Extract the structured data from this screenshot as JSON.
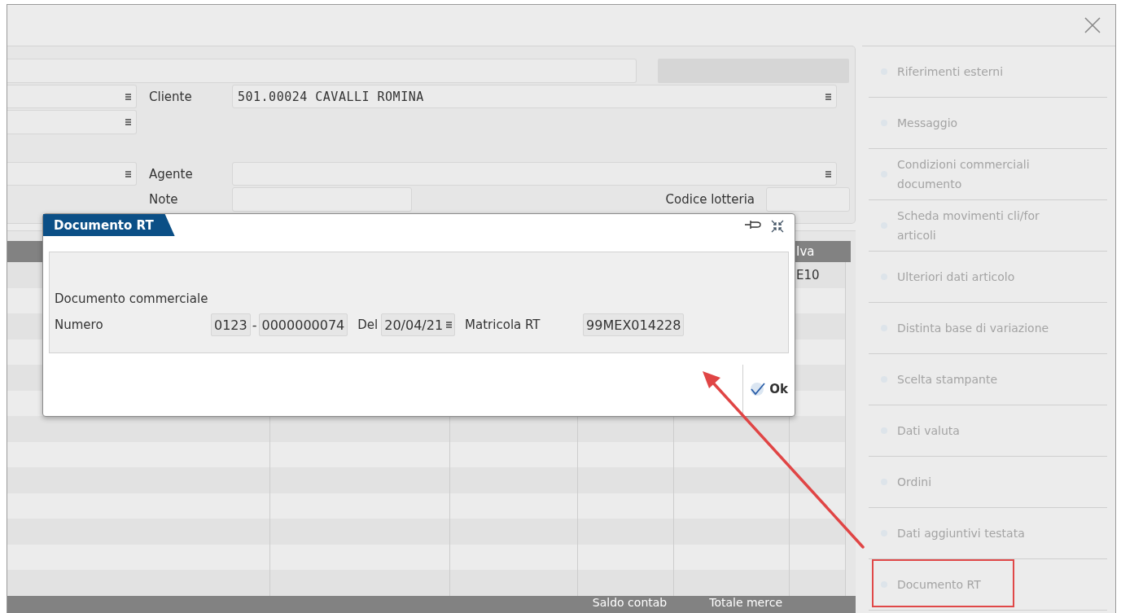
{
  "form": {
    "cliente": {
      "label": "Cliente",
      "value": "501.00024 CAVALLI ROMINA"
    },
    "agente": {
      "label": "Agente"
    },
    "note": {
      "label": "Note"
    },
    "codice_lotteria": {
      "label": "Codice lotteria"
    }
  },
  "table": {
    "iva_header": "Iva",
    "iva_values": [
      "E10"
    ]
  },
  "totals_bar": {
    "labels": [
      "Saldo contab",
      "Totale merce"
    ]
  },
  "side_menu": {
    "items": [
      {
        "label": "Riferimenti esterni",
        "highlighted": false
      },
      {
        "label": "Messaggio",
        "highlighted": false
      },
      {
        "label": "Condizioni commerciali documento",
        "highlighted": false
      },
      {
        "label": "Scheda movimenti cli/for articoli",
        "highlighted": false
      },
      {
        "label": "Ulteriori dati articolo",
        "highlighted": false
      },
      {
        "label": "Distinta base di variazione",
        "highlighted": false
      },
      {
        "label": "Scelta stampante",
        "highlighted": false
      },
      {
        "label": "Dati valuta",
        "highlighted": false
      },
      {
        "label": "Ordini",
        "highlighted": false
      },
      {
        "label": "Dati aggiuntivi testata",
        "highlighted": false
      },
      {
        "label": "Documento RT",
        "highlighted": true
      }
    ]
  },
  "dialog": {
    "title": "Documento RT",
    "section_label": "Documento commerciale",
    "numero_label": "Numero",
    "numero_prefix": "0123",
    "separator": "-",
    "numero": "0000000074",
    "del_label": "Del",
    "date": "20/04/21",
    "matricola_label": "Matricola RT",
    "matricola": "99MEX014228",
    "ok": "Ok"
  }
}
